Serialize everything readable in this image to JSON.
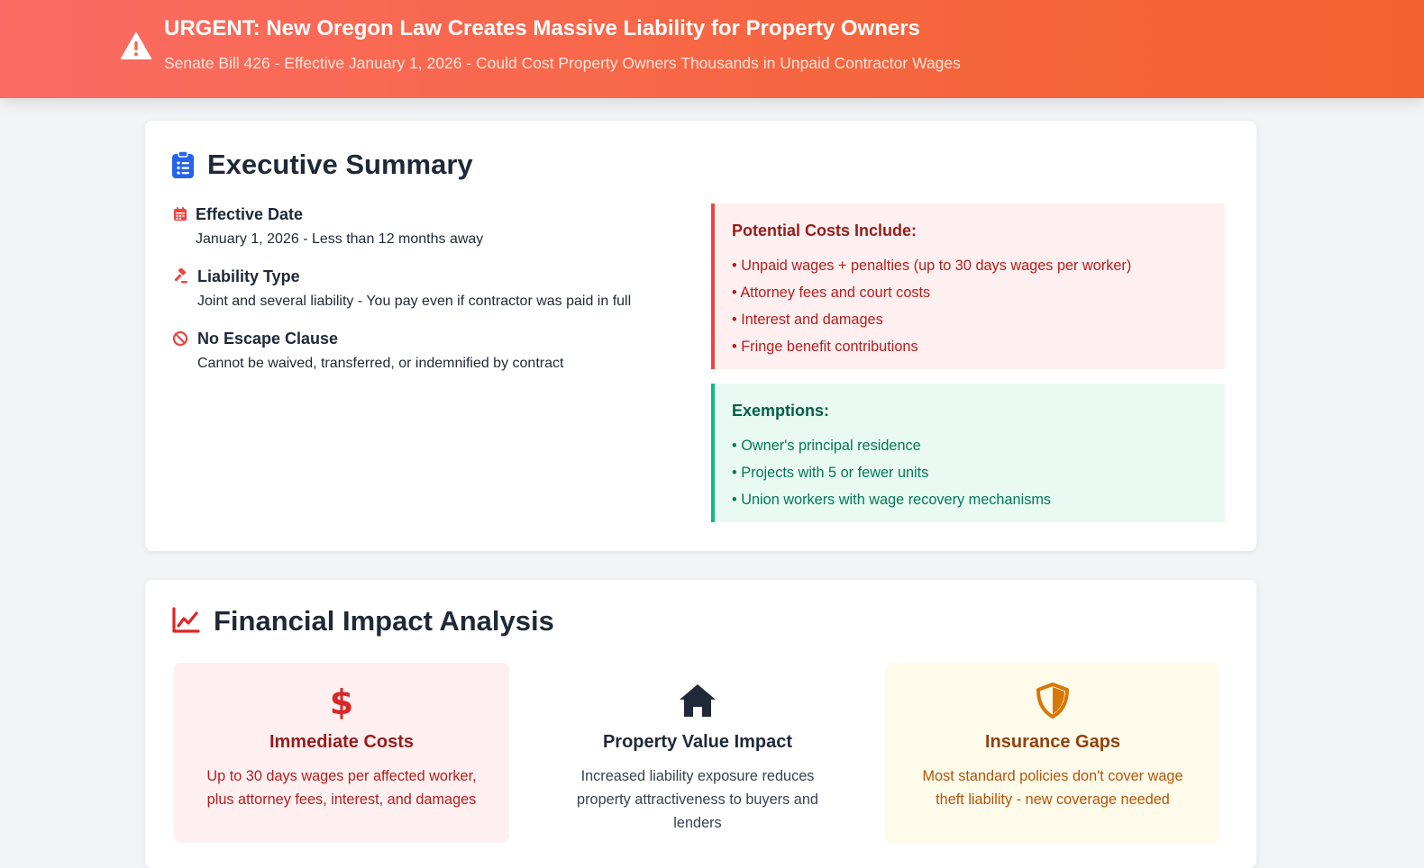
{
  "banner": {
    "icon": "warning-triangle-icon",
    "title": "URGENT: New Oregon Law Creates Massive Liability for Property Owners",
    "subtitle": "Senate Bill 426 - Effective January 1, 2026 - Could Cost Property Owners Thousands in Unpaid Contractor Wages"
  },
  "summary": {
    "icon": "clipboard-list-icon",
    "title": "Executive Summary",
    "items": [
      {
        "icon": "calendar-icon",
        "label": "Effective Date",
        "text": "January 1, 2026 - Less than 12 months away"
      },
      {
        "icon": "gavel-icon",
        "label": "Liability Type",
        "text": "Joint and several liability - You pay even if contractor was paid in full"
      },
      {
        "icon": "ban-icon",
        "label": "No Escape Clause",
        "text": "Cannot be waived, transferred, or indemnified by contract"
      }
    ],
    "costs": {
      "title": "Potential Costs Include:",
      "items": [
        "• Unpaid wages + penalties (up to 30 days wages per worker)",
        "• Attorney fees and court costs",
        "• Interest and damages",
        "• Fringe benefit contributions"
      ]
    },
    "exemptions": {
      "title": "Exemptions:",
      "items": [
        "• Owner's principal residence",
        "• Projects with 5 or fewer units",
        "• Union workers with wage recovery mechanisms"
      ]
    }
  },
  "financial": {
    "icon": "chart-line-icon",
    "title": "Financial Impact Analysis",
    "cards": [
      {
        "icon": "dollar-icon",
        "title": "Immediate Costs",
        "text": "Up to 30 days wages per affected worker, plus attorney fees, interest, and damages"
      },
      {
        "icon": "house-icon",
        "title": "Property Value Impact",
        "text": "Increased liability exposure reduces property attractiveness to buyers and lenders"
      },
      {
        "icon": "shield-icon",
        "title": "Insurance Gaps",
        "text": "Most standard policies don't cover wage theft liability - new coverage needed"
      }
    ]
  },
  "colors": {
    "banner_start": "#fb6b63",
    "banner_end": "#f26131",
    "danger": "#ef4444",
    "success": "#10b981",
    "warning": "#d97706",
    "primary": "#2563eb"
  }
}
